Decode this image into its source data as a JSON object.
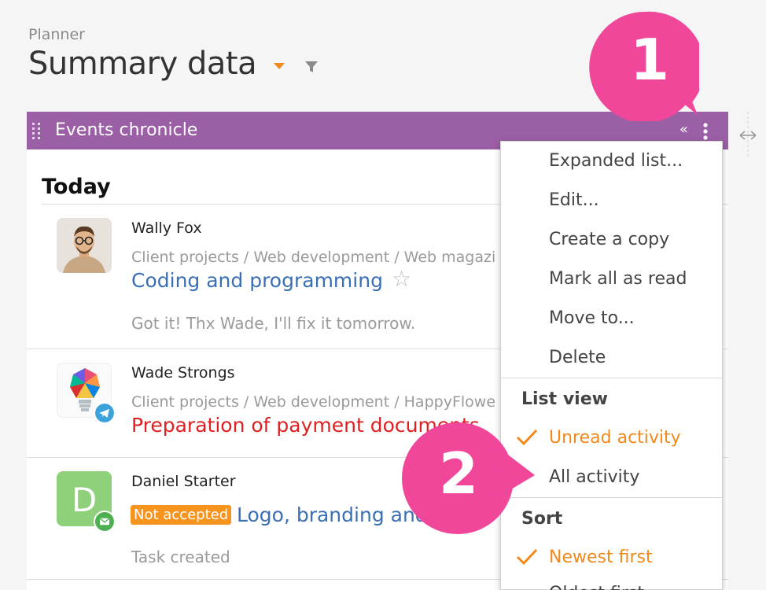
{
  "header": {
    "breadcrumb": "Planner",
    "title": "Summary data"
  },
  "panel": {
    "title": "Events chronicle",
    "section_heading": "Today",
    "events": [
      {
        "author": "Wally Fox",
        "path": "Client projects / Web development / Web magazi",
        "subject": "Coding and programming",
        "snippet": "Got it! Thx Wade, I'll fix it tomorrow."
      },
      {
        "author": "Wade Strongs",
        "path": "Client projects / Web development / HappyFlowe",
        "subject": "Preparation of payment documents"
      },
      {
        "author": "Daniel Starter",
        "avatar_letter": "D",
        "status_tag": "Not accepted",
        "subject": "Logo, branding and",
        "snippet": "Task created"
      }
    ]
  },
  "menu": {
    "items": [
      "Expanded list...",
      "Edit...",
      "Create a copy",
      "Mark all as read",
      "Move to...",
      "Delete"
    ],
    "list_view_heading": "List view",
    "list_view_options": [
      "Unread activity",
      "All activity"
    ],
    "sort_heading": "Sort",
    "sort_options": [
      "Newest first",
      "Oldest first"
    ]
  },
  "callouts": [
    "1",
    "2"
  ],
  "colors": {
    "panel_header": "#9b5fa6",
    "accent_orange": "#f08a1c",
    "link_blue": "#3a6fb5",
    "alert_red": "#e02020",
    "callout_pink": "#f0479b"
  }
}
